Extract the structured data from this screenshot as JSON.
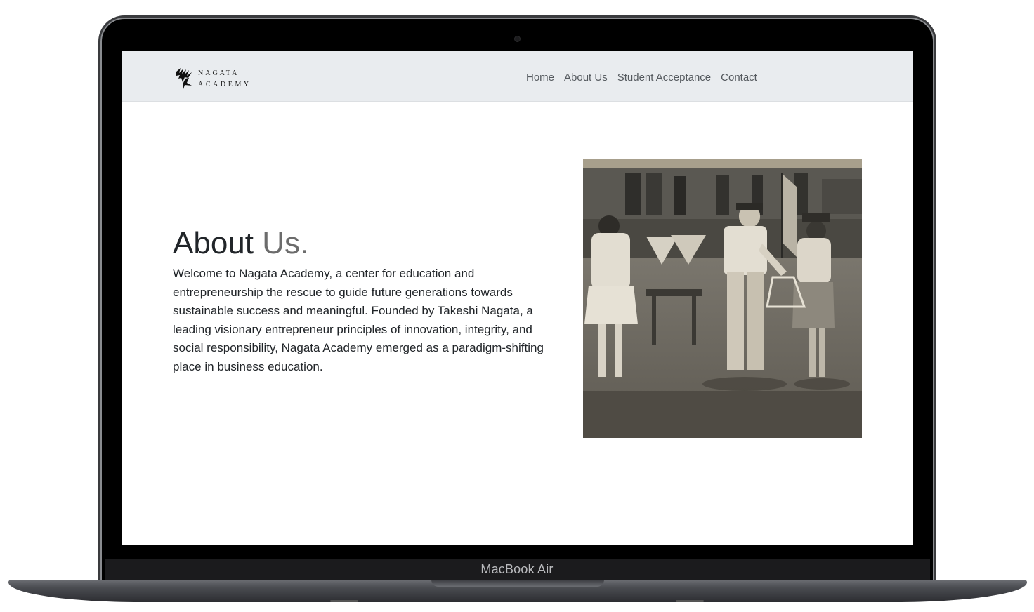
{
  "device": {
    "label": "MacBook Air"
  },
  "site": {
    "logo_line1": "NAGATA",
    "logo_line2": "ACADEMY"
  },
  "nav": {
    "items": [
      {
        "label": "Home"
      },
      {
        "label": "About Us"
      },
      {
        "label": "Student Acceptance"
      },
      {
        "label": "Contact"
      }
    ]
  },
  "about": {
    "heading_main": "About",
    "heading_accent": "Us.",
    "body": "Welcome to Nagata Academy, a center for education and entrepreneurship the rescue to guide future generations towards sustainable success and meaningful. Founded by Takeshi Nagata, a leading visionary entrepreneur principles of innovation, integrity, and social responsibility, Nagata Academy emerged as a paradigm-shifting place in business education."
  },
  "colors": {
    "navbar_bg": "#e9ecef",
    "heading_text": "#212529",
    "heading_accent": "#6c6c6c",
    "nav_text": "#555a5f"
  }
}
